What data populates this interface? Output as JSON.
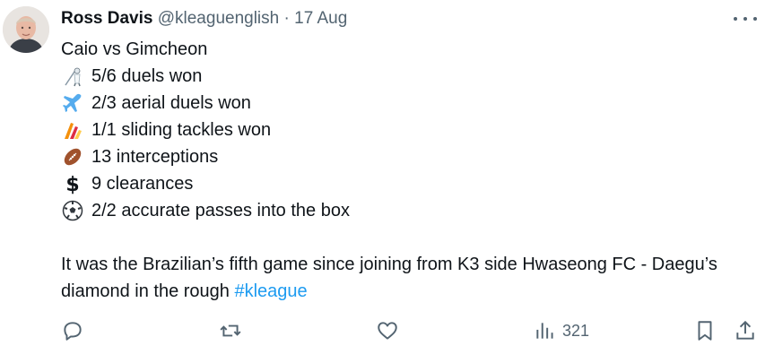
{
  "tweet": {
    "author_name": "Ross Davis",
    "handle": "@kleaguenglish",
    "separator": "·",
    "date": "17 Aug",
    "title_line": "Caio vs Gimcheon",
    "stats": [
      {
        "icon": "fencing-icon",
        "text": "5/6 duels won"
      },
      {
        "icon": "airplane-icon",
        "text": "2/3 aerial duels won"
      },
      {
        "icon": "slide-icon",
        "text": "1/1 sliding tackles won"
      },
      {
        "icon": "american-football-icon",
        "text": "13 interceptions"
      },
      {
        "icon": "dollar-sign-icon",
        "text": "9 clearances"
      },
      {
        "icon": "soccer-ball-icon",
        "text": "2/2 accurate passes into the box"
      }
    ],
    "paragraph": "It was the Brazilian’s fifth game since joining from K3 side Hwaseong FC - Daegu’s diamond in the rough",
    "hashtag": "#kleague"
  },
  "actions": {
    "views_count": "321",
    "icons": [
      "reply-icon",
      "retweet-icon",
      "like-icon",
      "views-icon",
      "bookmark-icon",
      "share-icon"
    ]
  },
  "colors": {
    "text": "#0f1419",
    "secondary": "#536471",
    "link": "#1d9bf0"
  }
}
